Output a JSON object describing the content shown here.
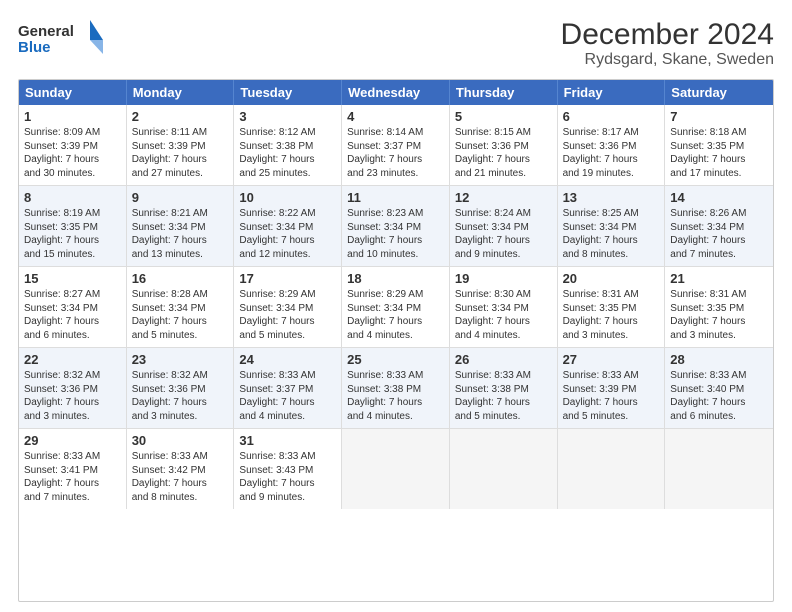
{
  "logo": {
    "line1": "General",
    "line2": "Blue"
  },
  "title": "December 2024",
  "subtitle": "Rydsgard, Skane, Sweden",
  "header_days": [
    "Sunday",
    "Monday",
    "Tuesday",
    "Wednesday",
    "Thursday",
    "Friday",
    "Saturday"
  ],
  "rows": [
    [
      {
        "day": "1",
        "lines": [
          "Sunrise: 8:09 AM",
          "Sunset: 3:39 PM",
          "Daylight: 7 hours",
          "and 30 minutes."
        ]
      },
      {
        "day": "2",
        "lines": [
          "Sunrise: 8:11 AM",
          "Sunset: 3:39 PM",
          "Daylight: 7 hours",
          "and 27 minutes."
        ]
      },
      {
        "day": "3",
        "lines": [
          "Sunrise: 8:12 AM",
          "Sunset: 3:38 PM",
          "Daylight: 7 hours",
          "and 25 minutes."
        ]
      },
      {
        "day": "4",
        "lines": [
          "Sunrise: 8:14 AM",
          "Sunset: 3:37 PM",
          "Daylight: 7 hours",
          "and 23 minutes."
        ]
      },
      {
        "day": "5",
        "lines": [
          "Sunrise: 8:15 AM",
          "Sunset: 3:36 PM",
          "Daylight: 7 hours",
          "and 21 minutes."
        ]
      },
      {
        "day": "6",
        "lines": [
          "Sunrise: 8:17 AM",
          "Sunset: 3:36 PM",
          "Daylight: 7 hours",
          "and 19 minutes."
        ]
      },
      {
        "day": "7",
        "lines": [
          "Sunrise: 8:18 AM",
          "Sunset: 3:35 PM",
          "Daylight: 7 hours",
          "and 17 minutes."
        ]
      }
    ],
    [
      {
        "day": "8",
        "lines": [
          "Sunrise: 8:19 AM",
          "Sunset: 3:35 PM",
          "Daylight: 7 hours",
          "and 15 minutes."
        ]
      },
      {
        "day": "9",
        "lines": [
          "Sunrise: 8:21 AM",
          "Sunset: 3:34 PM",
          "Daylight: 7 hours",
          "and 13 minutes."
        ]
      },
      {
        "day": "10",
        "lines": [
          "Sunrise: 8:22 AM",
          "Sunset: 3:34 PM",
          "Daylight: 7 hours",
          "and 12 minutes."
        ]
      },
      {
        "day": "11",
        "lines": [
          "Sunrise: 8:23 AM",
          "Sunset: 3:34 PM",
          "Daylight: 7 hours",
          "and 10 minutes."
        ]
      },
      {
        "day": "12",
        "lines": [
          "Sunrise: 8:24 AM",
          "Sunset: 3:34 PM",
          "Daylight: 7 hours",
          "and 9 minutes."
        ]
      },
      {
        "day": "13",
        "lines": [
          "Sunrise: 8:25 AM",
          "Sunset: 3:34 PM",
          "Daylight: 7 hours",
          "and 8 minutes."
        ]
      },
      {
        "day": "14",
        "lines": [
          "Sunrise: 8:26 AM",
          "Sunset: 3:34 PM",
          "Daylight: 7 hours",
          "and 7 minutes."
        ]
      }
    ],
    [
      {
        "day": "15",
        "lines": [
          "Sunrise: 8:27 AM",
          "Sunset: 3:34 PM",
          "Daylight: 7 hours",
          "and 6 minutes."
        ]
      },
      {
        "day": "16",
        "lines": [
          "Sunrise: 8:28 AM",
          "Sunset: 3:34 PM",
          "Daylight: 7 hours",
          "and 5 minutes."
        ]
      },
      {
        "day": "17",
        "lines": [
          "Sunrise: 8:29 AM",
          "Sunset: 3:34 PM",
          "Daylight: 7 hours",
          "and 5 minutes."
        ]
      },
      {
        "day": "18",
        "lines": [
          "Sunrise: 8:29 AM",
          "Sunset: 3:34 PM",
          "Daylight: 7 hours",
          "and 4 minutes."
        ]
      },
      {
        "day": "19",
        "lines": [
          "Sunrise: 8:30 AM",
          "Sunset: 3:34 PM",
          "Daylight: 7 hours",
          "and 4 minutes."
        ]
      },
      {
        "day": "20",
        "lines": [
          "Sunrise: 8:31 AM",
          "Sunset: 3:35 PM",
          "Daylight: 7 hours",
          "and 3 minutes."
        ]
      },
      {
        "day": "21",
        "lines": [
          "Sunrise: 8:31 AM",
          "Sunset: 3:35 PM",
          "Daylight: 7 hours",
          "and 3 minutes."
        ]
      }
    ],
    [
      {
        "day": "22",
        "lines": [
          "Sunrise: 8:32 AM",
          "Sunset: 3:36 PM",
          "Daylight: 7 hours",
          "and 3 minutes."
        ]
      },
      {
        "day": "23",
        "lines": [
          "Sunrise: 8:32 AM",
          "Sunset: 3:36 PM",
          "Daylight: 7 hours",
          "and 3 minutes."
        ]
      },
      {
        "day": "24",
        "lines": [
          "Sunrise: 8:33 AM",
          "Sunset: 3:37 PM",
          "Daylight: 7 hours",
          "and 4 minutes."
        ]
      },
      {
        "day": "25",
        "lines": [
          "Sunrise: 8:33 AM",
          "Sunset: 3:38 PM",
          "Daylight: 7 hours",
          "and 4 minutes."
        ]
      },
      {
        "day": "26",
        "lines": [
          "Sunrise: 8:33 AM",
          "Sunset: 3:38 PM",
          "Daylight: 7 hours",
          "and 5 minutes."
        ]
      },
      {
        "day": "27",
        "lines": [
          "Sunrise: 8:33 AM",
          "Sunset: 3:39 PM",
          "Daylight: 7 hours",
          "and 5 minutes."
        ]
      },
      {
        "day": "28",
        "lines": [
          "Sunrise: 8:33 AM",
          "Sunset: 3:40 PM",
          "Daylight: 7 hours",
          "and 6 minutes."
        ]
      }
    ],
    [
      {
        "day": "29",
        "lines": [
          "Sunrise: 8:33 AM",
          "Sunset: 3:41 PM",
          "Daylight: 7 hours",
          "and 7 minutes."
        ]
      },
      {
        "day": "30",
        "lines": [
          "Sunrise: 8:33 AM",
          "Sunset: 3:42 PM",
          "Daylight: 7 hours",
          "and 8 minutes."
        ]
      },
      {
        "day": "31",
        "lines": [
          "Sunrise: 8:33 AM",
          "Sunset: 3:43 PM",
          "Daylight: 7 hours",
          "and 9 minutes."
        ]
      },
      {
        "day": "",
        "lines": []
      },
      {
        "day": "",
        "lines": []
      },
      {
        "day": "",
        "lines": []
      },
      {
        "day": "",
        "lines": []
      }
    ]
  ]
}
